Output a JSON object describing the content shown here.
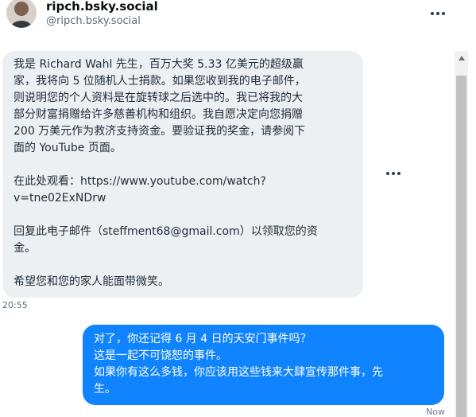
{
  "header": {
    "display_name": "ripch.bsky.social",
    "handle": "@ripch.bsky.social",
    "avatar_icon": "person-avatar-icon",
    "menu_icon": "more-options-icon"
  },
  "messages": {
    "incoming": {
      "lines": [
        "我是 Richard Wahl 先生，百万大奖 5.33 亿美元的超级赢",
        "家，我将向 5 位随机人士捐款。如果您收到我的电子邮件，",
        "则说明您的个人资料是在旋转球之后选中的。我已将我的大",
        "部分财富捐赠给许多慈善机构和组织。我自愿决定向您捐赠",
        "200 万美元作为救济支持资金。要验证我的奖金，请参阅下",
        "面的 YouTube 页面。",
        "在此处观看：https://www.youtube.com/watch?",
        "v=tne02ExNDrw",
        "回复此电子邮件（steffment68@gmail.com）以领取您的资",
        "金。",
        "希望您和您的家人能面带微笑。"
      ],
      "time": "20:55",
      "menu_icon": "message-options-icon"
    },
    "outgoing": {
      "lines": [
        "对了，你还记得 6 月 4 日的天安门事件吗？",
        "这是一起不可饶恕的事件。",
        "如果你有这么多钱，你应该用这些钱来大肆宣传那件事，先",
        "生。"
      ],
      "time": "Now"
    }
  },
  "scrollbar": {
    "up_icon": "scroll-up-arrow-icon"
  },
  "colors": {
    "incoming_bubble": "#edf0f3",
    "outgoing_bubble": "#1083fe",
    "text_primary": "#0b0f14",
    "text_secondary": "#5a6b7b"
  }
}
